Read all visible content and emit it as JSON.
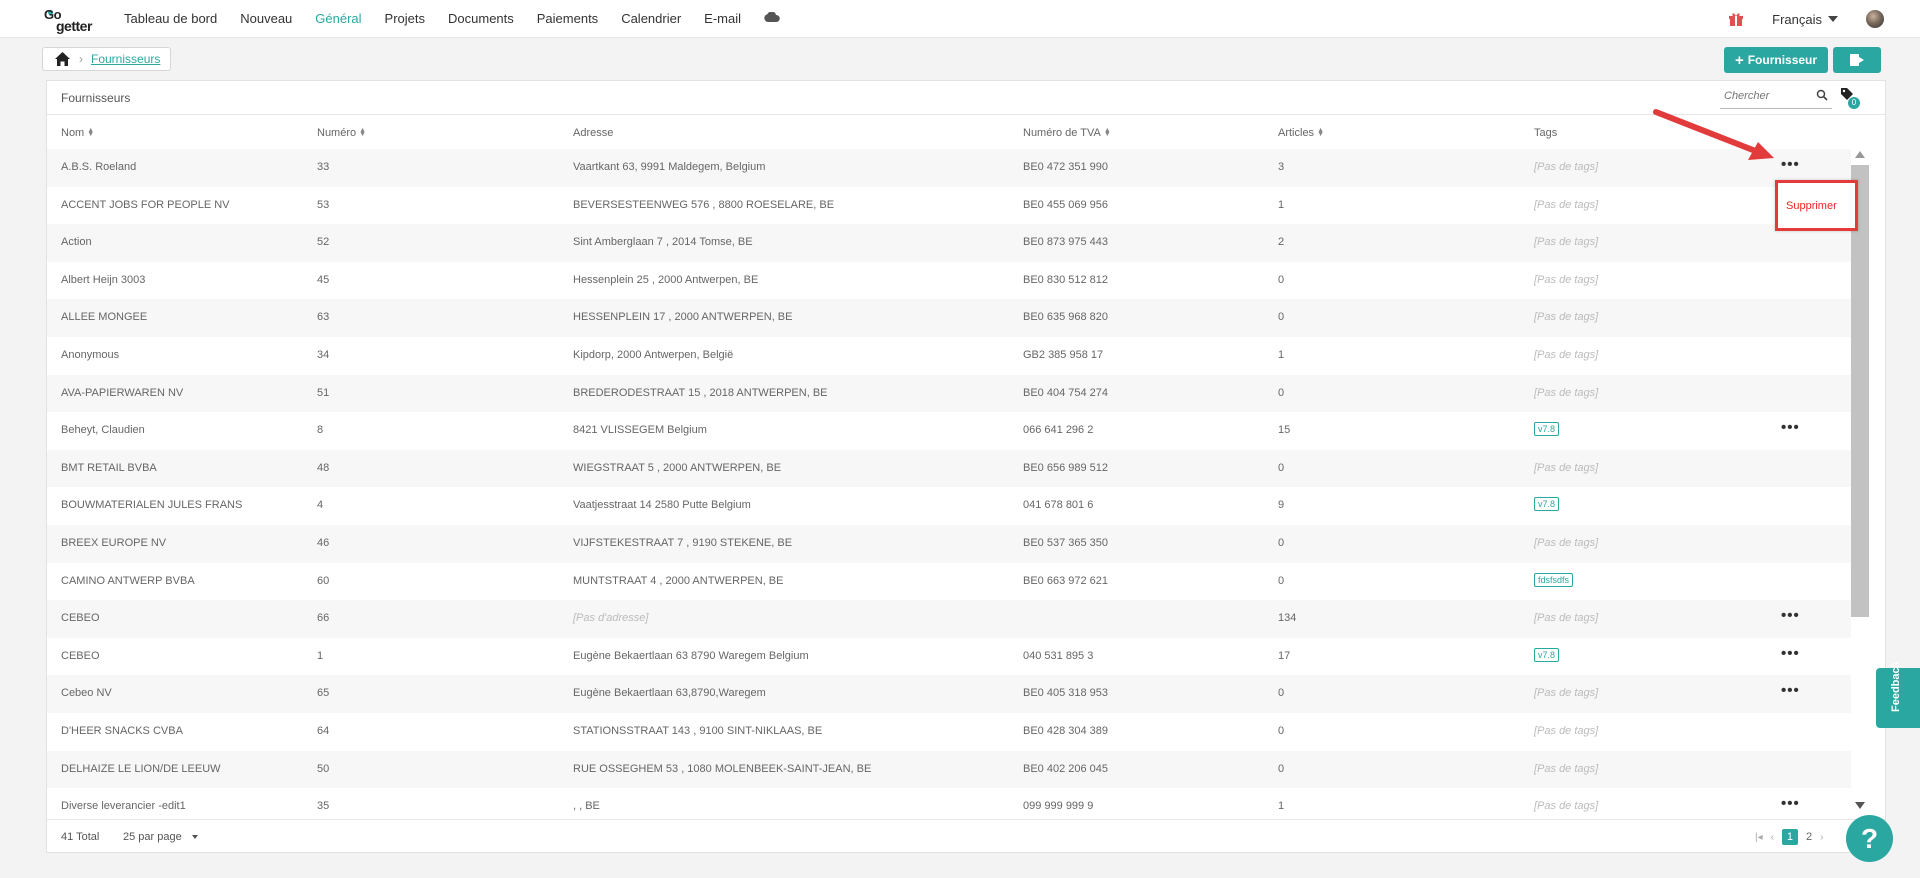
{
  "topbar": {
    "logo": {
      "top": "Go",
      "bottom": "getter"
    },
    "nav": [
      {
        "label": "Tableau de bord",
        "active": false
      },
      {
        "label": "Nouveau",
        "active": false
      },
      {
        "label": "Général",
        "active": true
      },
      {
        "label": "Projets",
        "active": false
      },
      {
        "label": "Documents",
        "active": false
      },
      {
        "label": "Paiements",
        "active": false
      },
      {
        "label": "Calendrier",
        "active": false
      },
      {
        "label": "E-mail",
        "active": false
      }
    ],
    "cloud_icon": "cloud-icon",
    "gift_icon": "gift-icon",
    "language": "Français"
  },
  "breadcrumb": {
    "home_icon": "home-icon",
    "current": "Fournisseurs"
  },
  "actions": {
    "add_label": "Fournisseur",
    "export_icon": "export-icon"
  },
  "panel": {
    "title": "Fournisseurs",
    "search_placeholder": "Chercher",
    "tag_badge": "0"
  },
  "table": {
    "columns": [
      "Nom",
      "Numéro",
      "Adresse",
      "Numéro de TVA",
      "Articles",
      "Tags"
    ],
    "rows": [
      {
        "nom": "A.B.S. Roeland",
        "numero": "33",
        "adresse": "Vaartkant 63, 9991 Maldegem, Belgium",
        "tva": "BE0 472 351 990",
        "articles": "3",
        "tags": "[Pas de tags]",
        "has_tag": false,
        "menu": true
      },
      {
        "nom": "ACCENT JOBS FOR PEOPLE NV",
        "numero": "53",
        "adresse": "BEVERSESTEENWEG 576 , 8800 ROESELARE, BE",
        "tva": "BE0 455 069 956",
        "articles": "1",
        "tags": "[Pas de tags]",
        "has_tag": false,
        "menu": false
      },
      {
        "nom": "Action",
        "numero": "52",
        "adresse": "Sint Amberglaan 7 , 2014 Tomse, BE",
        "tva": "BE0 873 975 443",
        "articles": "2",
        "tags": "[Pas de tags]",
        "has_tag": false,
        "menu": false
      },
      {
        "nom": "Albert Heijn 3003",
        "numero": "45",
        "adresse": "Hessenplein 25 , 2000 Antwerpen, BE",
        "tva": "BE0 830 512 812",
        "articles": "0",
        "tags": "[Pas de tags]",
        "has_tag": false,
        "menu": false
      },
      {
        "nom": "ALLEE MONGEE",
        "numero": "63",
        "adresse": "HESSENPLEIN 17 , 2000 ANTWERPEN, BE",
        "tva": "BE0 635 968 820",
        "articles": "0",
        "tags": "[Pas de tags]",
        "has_tag": false,
        "menu": false
      },
      {
        "nom": "Anonymous",
        "numero": "34",
        "adresse": "Kipdorp, 2000 Antwerpen, België",
        "tva": "GB2 385 958 17",
        "articles": "1",
        "tags": "[Pas de tags]",
        "has_tag": false,
        "menu": false
      },
      {
        "nom": "AVA-PAPIERWAREN NV",
        "numero": "51",
        "adresse": "BREDERODESTRAAT 15 , 2018 ANTWERPEN, BE",
        "tva": "BE0 404 754 274",
        "articles": "0",
        "tags": "[Pas de tags]",
        "has_tag": false,
        "menu": false
      },
      {
        "nom": "Beheyt, Claudien",
        "numero": "8",
        "adresse": "8421 VLISSEGEM Belgium",
        "tva": "066 641 296 2",
        "articles": "15",
        "tags": "v7.8",
        "has_tag": true,
        "menu": true
      },
      {
        "nom": "BMT RETAIL BVBA",
        "numero": "48",
        "adresse": "WIEGSTRAAT 5 , 2000 ANTWERPEN, BE",
        "tva": "BE0 656 989 512",
        "articles": "0",
        "tags": "[Pas de tags]",
        "has_tag": false,
        "menu": false
      },
      {
        "nom": "BOUWMATERIALEN JULES FRANS",
        "numero": "4",
        "adresse": "Vaatjesstraat 14 2580 Putte Belgium",
        "tva": "041 678 801 6",
        "articles": "9",
        "tags": "v7.8",
        "has_tag": true,
        "menu": false
      },
      {
        "nom": "BREEX EUROPE NV",
        "numero": "46",
        "adresse": "VIJFSTEKESTRAAT 7 , 9190 STEKENE, BE",
        "tva": "BE0 537 365 350",
        "articles": "0",
        "tags": "[Pas de tags]",
        "has_tag": false,
        "menu": false
      },
      {
        "nom": "CAMINO ANTWERP BVBA",
        "numero": "60",
        "adresse": "MUNTSTRAAT 4 , 2000 ANTWERPEN, BE",
        "tva": "BE0 663 972 621",
        "articles": "0",
        "tags": "fdsfsdfs",
        "has_tag": true,
        "menu": false
      },
      {
        "nom": "CEBEO",
        "numero": "66",
        "adresse": "[Pas d'adresse]",
        "tva": "",
        "articles": "134",
        "tags": "[Pas de tags]",
        "has_tag": false,
        "menu": true,
        "empty_address": true
      },
      {
        "nom": "CEBEO",
        "numero": "1",
        "adresse": "Eugène Bekaertlaan 63 8790 Waregem Belgium",
        "tva": "040 531 895 3",
        "articles": "17",
        "tags": "v7.8",
        "has_tag": true,
        "menu": true
      },
      {
        "nom": "Cebeo NV",
        "numero": "65",
        "adresse": "Eugène Bekaertlaan 63,8790,Waregem",
        "tva": "BE0 405 318 953",
        "articles": "0",
        "tags": "[Pas de tags]",
        "has_tag": false,
        "menu": true
      },
      {
        "nom": "D'HEER SNACKS CVBA",
        "numero": "64",
        "adresse": "STATIONSSTRAAT 143 , 9100 SINT-NIKLAAS, BE",
        "tva": "BE0 428 304 389",
        "articles": "0",
        "tags": "[Pas de tags]",
        "has_tag": false,
        "menu": false
      },
      {
        "nom": "DELHAIZE LE LION/DE LEEUW",
        "numero": "50",
        "adresse": "RUE OSSEGHEM 53 , 1080 MOLENBEEK-SAINT-JEAN, BE",
        "tva": "BE0 402 206 045",
        "articles": "0",
        "tags": "[Pas de tags]",
        "has_tag": false,
        "menu": false
      },
      {
        "nom": "Diverse leverancier -edit1",
        "numero": "35",
        "adresse": ", , BE",
        "tva": "099 999 999 9",
        "articles": "1",
        "tags": "[Pas de tags]",
        "has_tag": false,
        "menu": true
      }
    ]
  },
  "footer": {
    "total": "41 Total",
    "per_page": "25 par page",
    "pages": [
      "1",
      "2"
    ],
    "current_page": "1"
  },
  "popup": {
    "delete_label": "Supprimer"
  },
  "feedback_label": "Feedback",
  "help_label": "?",
  "colors": {
    "accent": "#2aa7a1",
    "danger": "#e23b3b"
  }
}
